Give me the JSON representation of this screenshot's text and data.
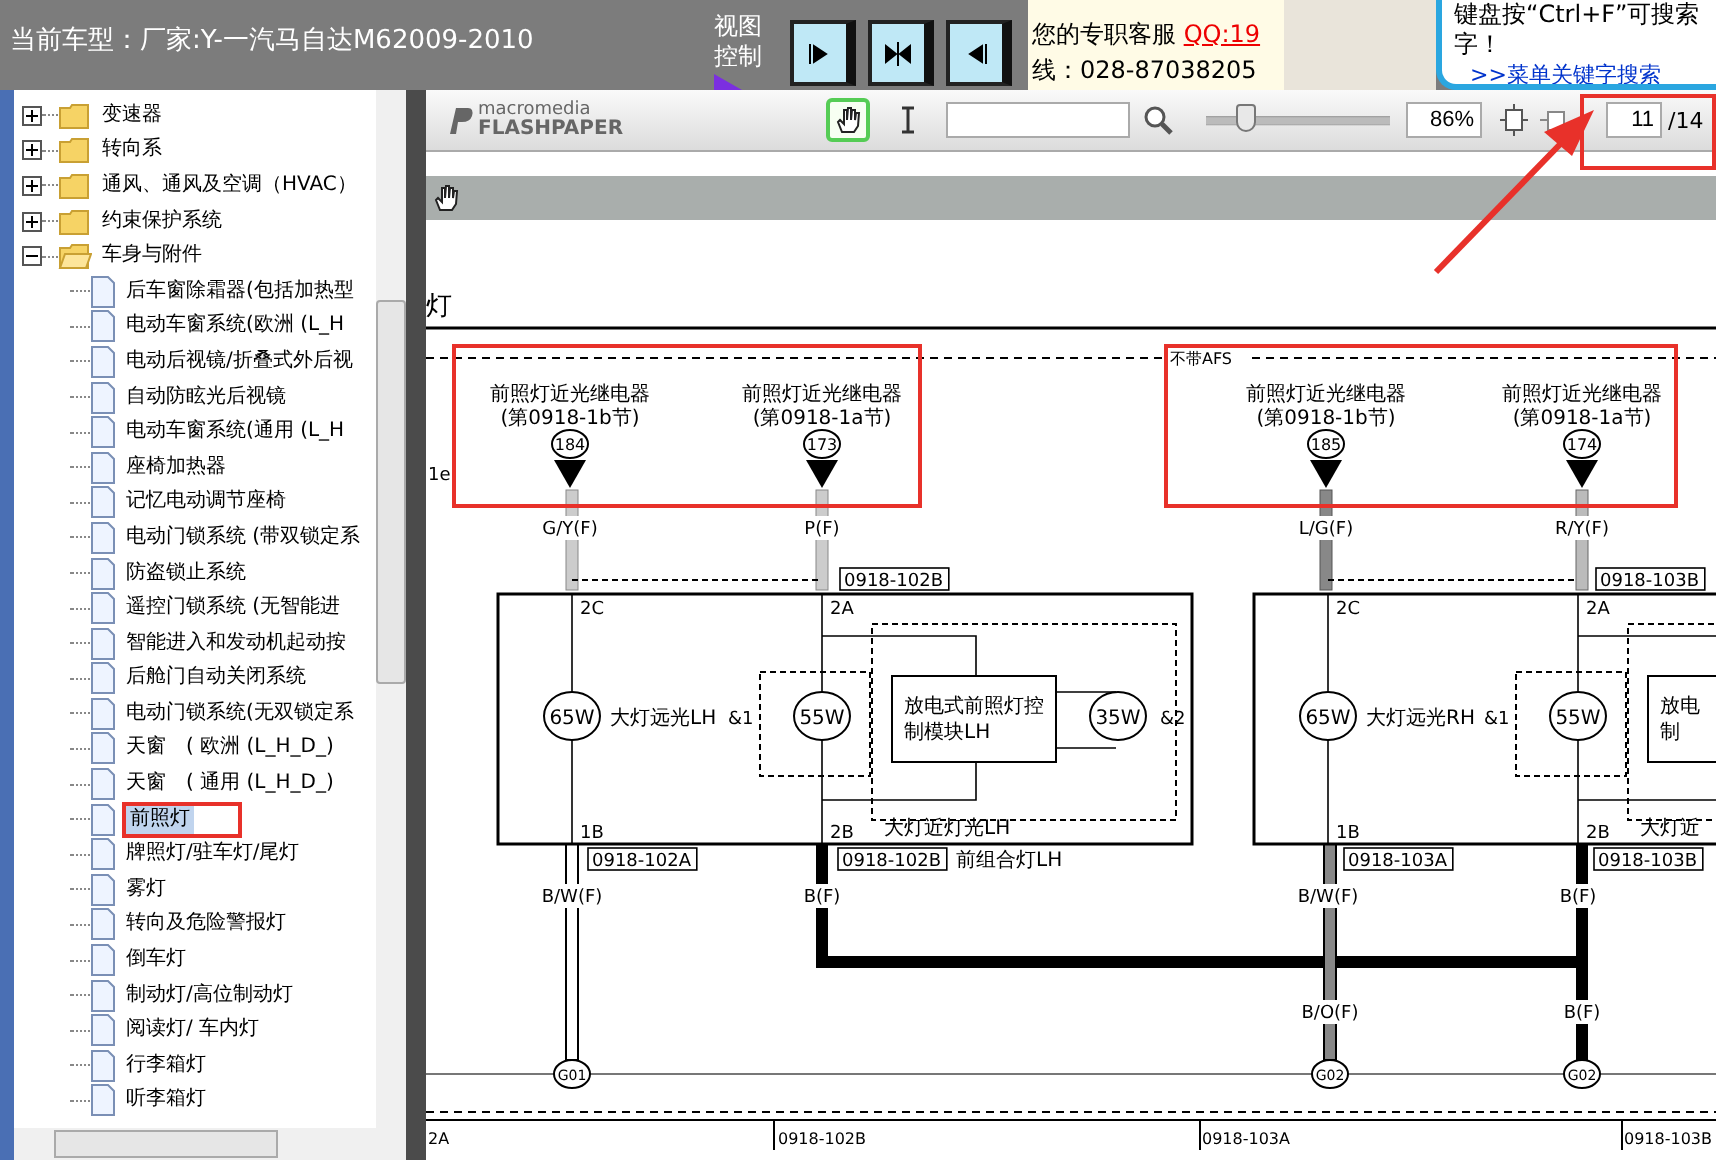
{
  "header": {
    "title": "当前车型：厂家:Y-一汽马自达M62009-2010",
    "view_control": "视图控制"
  },
  "support": {
    "text": "您的专职客服",
    "qq": "QQ:19",
    "phone": "线：028-87038205"
  },
  "tip": {
    "line_1": "键盘按“Ctrl+F”可搜索",
    "line_2": "字！",
    "link": ">>菜单关键字搜索"
  },
  "tree": {
    "items": [
      {
        "label": "变速器",
        "expanded": false
      },
      {
        "label": "转向系",
        "expanded": false
      },
      {
        "label": "通风、通风及空调（HVAC）",
        "expanded": false
      },
      {
        "label": "约束保护系统",
        "expanded": false
      },
      {
        "label": "车身与附件",
        "expanded": true,
        "children": [
          {
            "label": "后车窗除霜器(包括加热型",
            "selected": false
          },
          {
            "label": "电动车窗系统(欧洲 (L_H",
            "selected": false
          },
          {
            "label": "电动后视镜/折叠式外后视",
            "selected": false
          },
          {
            "label": "自动防眩光后视镜",
            "selected": false
          },
          {
            "label": "电动车窗系统(通用 (L_H",
            "selected": false
          },
          {
            "label": "座椅加热器",
            "selected": false
          },
          {
            "label": "记忆电动调节座椅",
            "selected": false
          },
          {
            "label": "电动门锁系统 (带双锁定系",
            "selected": false
          },
          {
            "label": "防盗锁止系统",
            "selected": false
          },
          {
            "label": "遥控门锁系统 (无智能进",
            "selected": false
          },
          {
            "label": "智能进入和发动机起动按",
            "selected": false
          },
          {
            "label": "后舱门自动关闭系统",
            "selected": false
          },
          {
            "label": "电动门锁系统(无双锁定系",
            "selected": false
          },
          {
            "label": "天窗　( 欧洲 (L_H_D_)",
            "selected": false
          },
          {
            "label": "天窗　( 通用 (L_H_D_)",
            "selected": false
          },
          {
            "label": "前照灯",
            "selected": true
          },
          {
            "label": "牌照灯/驻车灯/尾灯",
            "selected": false
          },
          {
            "label": "雾灯",
            "selected": false
          },
          {
            "label": "转向及危险警报灯",
            "selected": false
          },
          {
            "label": "倒车灯",
            "selected": false
          },
          {
            "label": "制动灯/高位制动灯",
            "selected": false
          },
          {
            "label": "阅读灯/ 车内灯",
            "selected": false
          },
          {
            "label": "行李箱灯",
            "selected": false
          },
          {
            "label": "听李箱灯",
            "selected": false
          }
        ]
      }
    ]
  },
  "viewer": {
    "logo_top": "macromedia",
    "logo_bottom": "FLASHPAPER",
    "tools": [
      {
        "kind": "hand",
        "selected": true
      },
      {
        "kind": "text",
        "selected": false
      }
    ],
    "zoom_slider": {
      "level": 0.22
    },
    "zoom": "86%",
    "page": "11",
    "page_total": "/14"
  },
  "diagram": {
    "title": "灯",
    "edge_label": "1e",
    "afs_label": "不带AFS",
    "relays": [
      {
        "name": "前照灯近光继电器",
        "section": "(第0918-1b节)",
        "pin": "184",
        "wire": "G/Y(F)"
      },
      {
        "name": "前照灯近光继电器",
        "section": "(第0918-1a节)",
        "pin": "173",
        "wire": "P(F)"
      },
      {
        "name": "前照灯近光继电器",
        "section": "(第0918-1b节)",
        "pin": "185",
        "wire": "L/G(F)"
      },
      {
        "name": "前照灯近光继电器",
        "section": "(第0918-1a节)",
        "pin": "174",
        "wire": "R/Y(F)"
      }
    ],
    "lamps": [
      {
        "connector_top": "0918-102B",
        "pins_top": [
          "2C",
          "2A"
        ],
        "high_bulb": "65W",
        "high_label": "大灯远光LH",
        "group_1": "&1",
        "low_bulb": "55W",
        "module": [
          "放电式前照灯控",
          "制模块LH"
        ],
        "ignitor_bulb": "35W",
        "group_2": "&2",
        "pins_bottom": [
          "1B",
          "2B"
        ],
        "low_label": "大灯近灯光LH",
        "connectors_bottom": [
          "0918-102A",
          "0918-102B"
        ],
        "assembly": "前组合灯LH",
        "wires_bottom": [
          "B/W(F)",
          "B(F)"
        ]
      },
      {
        "connector_top": "0918-103B",
        "pins_top": [
          "2C",
          "2A"
        ],
        "high_bulb": "65W",
        "high_label": "大灯远光RH",
        "group_1": "&1",
        "low_bulb": "55W",
        "module": [
          "放电",
          "制"
        ],
        "pins_bottom": [
          "1B",
          "2B"
        ],
        "low_label": "大灯近",
        "connectors_bottom": [
          "0918-103A",
          "0918-103B"
        ],
        "wires_bottom": [
          "B/W(F)",
          "B(F)"
        ]
      }
    ],
    "lower_wires": [
      "B/O(F)",
      "B(F)"
    ],
    "grounds": [
      "G01",
      "G02",
      "G02"
    ],
    "footer_cells": [
      "2A",
      "0918-102B",
      "0918-103A",
      "0918-103B"
    ]
  }
}
